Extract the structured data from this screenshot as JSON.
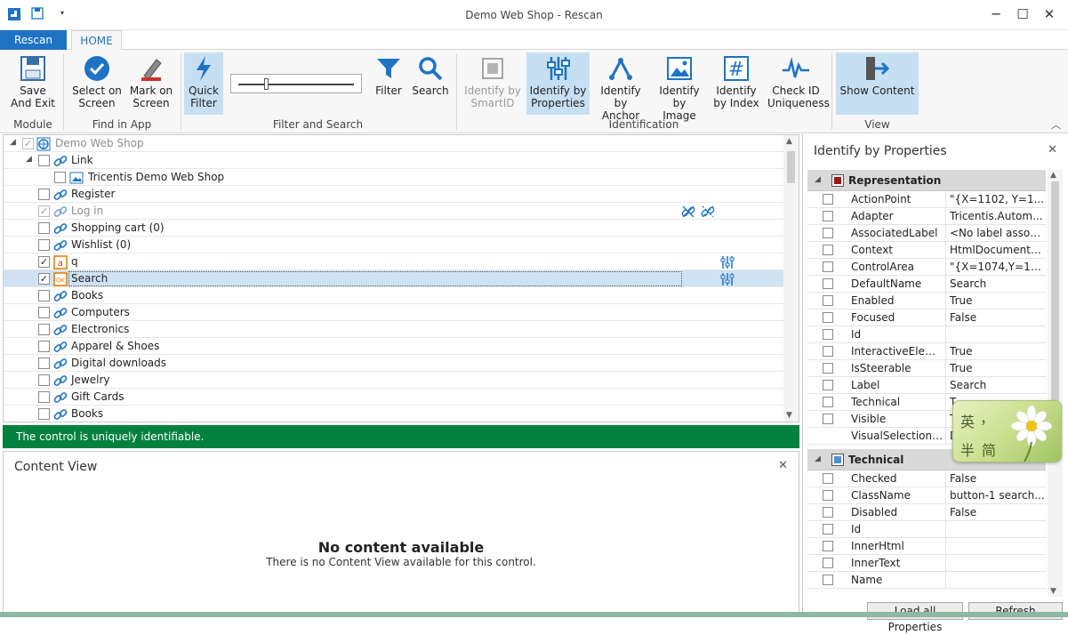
{
  "window": {
    "title": "Demo Web Shop - Rescan"
  },
  "tabs": {
    "rescan": "Rescan",
    "home": "HOME"
  },
  "ribbon": {
    "save_exit": "Save And Exit",
    "select_on_screen": "Select on Screen",
    "mark_on_screen": "Mark on Screen",
    "quick_filter": "Quick Filter",
    "filter": "Filter",
    "search": "Search",
    "identify_smartid": "Identify by SmartID",
    "identify_properties": "Identify by Properties",
    "identify_anchor": "Identify by Anchor",
    "identify_image": "Identify by Image",
    "identify_index": "Identify by Index",
    "check_id": "Check ID Uniqueness",
    "show_content": "Show Content",
    "groups": {
      "module": "Module",
      "find_in_app": "Find in App",
      "filter_search": "Filter and Search",
      "identification": "Identification",
      "view": "View"
    },
    "colors": {
      "accent": "#1e73c4",
      "selected": "#c7dff2"
    }
  },
  "tree": {
    "rows": [
      {
        "label": "Demo Web Shop",
        "icon": "globe-icon",
        "checked": "dim"
      },
      {
        "label": "Link",
        "icon": "link-icon",
        "checked": ""
      },
      {
        "label": "Tricentis Demo Web Shop",
        "icon": "image-icon",
        "checked": ""
      },
      {
        "label": "Register",
        "icon": "link-icon",
        "checked": ""
      },
      {
        "label": "Log in",
        "icon": "link-icon",
        "checked": "dim"
      },
      {
        "label": "Shopping cart (0)",
        "icon": "link-icon",
        "checked": ""
      },
      {
        "label": "Wishlist (0)",
        "icon": "link-icon",
        "checked": ""
      },
      {
        "label": "q",
        "icon": "textbox-icon",
        "checked": "yes"
      },
      {
        "label": "Search",
        "icon": "button-icon",
        "checked": "yes"
      },
      {
        "label": "Books",
        "icon": "link-icon",
        "checked": ""
      },
      {
        "label": "Computers",
        "icon": "link-icon",
        "checked": ""
      },
      {
        "label": "Electronics",
        "icon": "link-icon",
        "checked": ""
      },
      {
        "label": "Apparel & Shoes",
        "icon": "link-icon",
        "checked": ""
      },
      {
        "label": "Digital downloads",
        "icon": "link-icon",
        "checked": ""
      },
      {
        "label": "Jewelry",
        "icon": "link-icon",
        "checked": ""
      },
      {
        "label": "Gift Cards",
        "icon": "link-icon",
        "checked": ""
      },
      {
        "label": "Books",
        "icon": "link-icon",
        "checked": ""
      }
    ]
  },
  "status": {
    "text": "The control is uniquely identifiable.",
    "color": "#00813e"
  },
  "content_view": {
    "title": "Content View",
    "empty_title": "No content available",
    "empty_sub": "There is no Content View available for this control."
  },
  "identify_panel": {
    "title": "Identify by Properties",
    "categories": [
      {
        "name": "Representation",
        "color": "#a01515",
        "props": [
          {
            "name": "ActionPoint",
            "value": "\"{X=1102, Y=1..."
          },
          {
            "name": "Adapter",
            "value": "Tricentis.Autom..."
          },
          {
            "name": "AssociatedLabel",
            "value": "<No label associ..."
          },
          {
            "name": "Context",
            "value": "HtmlDocumentA..."
          },
          {
            "name": "ControlArea",
            "value": "\"{X=1074,Y=18..."
          },
          {
            "name": "DefaultName",
            "value": "Search"
          },
          {
            "name": "Enabled",
            "value": "True"
          },
          {
            "name": "Focused",
            "value": "False"
          },
          {
            "name": "Id",
            "value": ""
          },
          {
            "name": "InteractiveElem...",
            "value": "True"
          },
          {
            "name": "IsSteerable",
            "value": "True"
          },
          {
            "name": "Label",
            "value": "Search"
          },
          {
            "name": "Technical",
            "value": "T"
          },
          {
            "name": "Visible",
            "value": "T"
          },
          {
            "name": "VisualSelectionP...",
            "value": "D"
          }
        ]
      },
      {
        "name": "Technical",
        "color": "#4a90d9",
        "props": [
          {
            "name": "Checked",
            "value": "False"
          },
          {
            "name": "ClassName",
            "value": "button-1 search..."
          },
          {
            "name": "Disabled",
            "value": "False"
          },
          {
            "name": "Id",
            "value": ""
          },
          {
            "name": "InnerHtml",
            "value": ""
          },
          {
            "name": "InnerText",
            "value": ""
          },
          {
            "name": "Name",
            "value": ""
          }
        ]
      }
    ],
    "load_all": "Load all Properties",
    "refresh": "Refresh"
  },
  "ime": {
    "c1": "英",
    "c2": "，",
    "c3": "半",
    "c4": "简"
  }
}
